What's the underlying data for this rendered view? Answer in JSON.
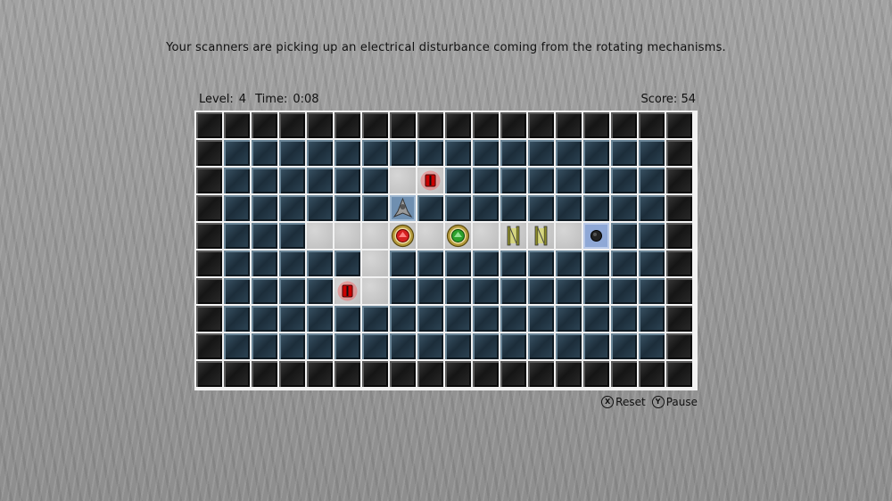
{
  "message": "Your scanners are picking up an electrical disturbance coming from the rotating mechanisms.",
  "hud": {
    "level_label": "Level:",
    "level_value": "4",
    "time_label": "Time:",
    "time_value": "0:08",
    "score_label": "Score:",
    "score_value": "54"
  },
  "controls": {
    "reset_glyph": "X",
    "reset_label": "Reset",
    "pause_glyph": "Y",
    "pause_label": "Pause"
  },
  "board": {
    "cols": 18,
    "rows": 10,
    "legend": {
      "O": "outer-wall",
      "W": "inner-wall",
      ".": "floor",
      "P": "player",
      "E": "exit",
      "r": "red-battery",
      "g": "rotator-red",
      "h": "rotator-green",
      "b": "barrier-gate"
    },
    "layout": [
      "OOOOOOOOOOOOOOOOOO",
      "OWWWWWWWWWWWWWWWWO",
      "OWWWWWW.rWWWWWWWWO",
      "OWWWWWWPWWWWWWWWWO",
      "OWWW...g.h.bb.EWWO",
      "OWWWWW.WWWWWWWWWWO",
      "OWWWWr.WWWWWWWWWWO",
      "OWWWWWWWWWWWWWWWWO",
      "OWWWWWWWWWWWWWWWWO",
      "OOOOOOOOOOOOOOOOOO"
    ]
  }
}
